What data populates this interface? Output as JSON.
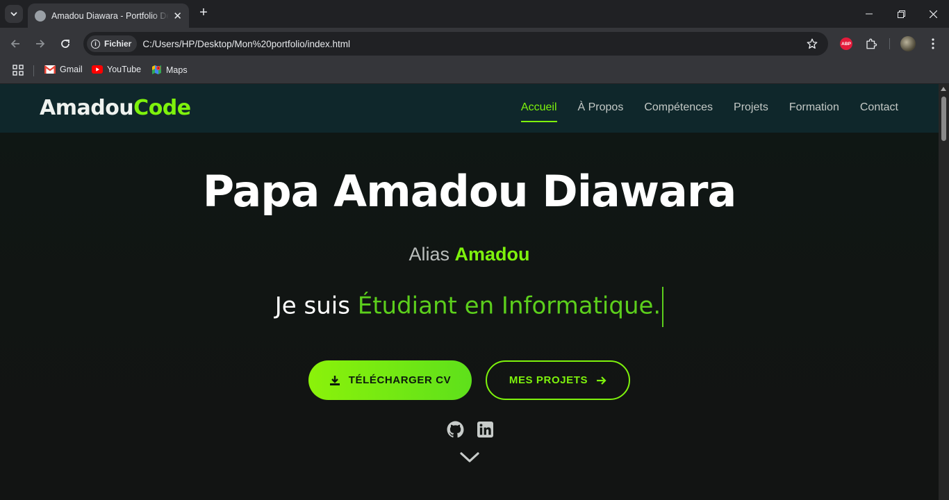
{
  "browser": {
    "tab_title": "Amadou Diawara - Portfolio Dé",
    "url_chip": "Fichier",
    "url": "C:/Users/HP/Desktop/Mon%20portfolio/index.html",
    "bookmarks": [
      {
        "label": "Gmail",
        "icon": "gmail-icon"
      },
      {
        "label": "YouTube",
        "icon": "youtube-icon"
      },
      {
        "label": "Maps",
        "icon": "maps-icon"
      }
    ],
    "extension_badge": "ABP"
  },
  "site": {
    "logo_main": "Amadou",
    "logo_accent": "Code",
    "nav": [
      "Accueil",
      "À Propos",
      "Compétences",
      "Projets",
      "Formation",
      "Contact"
    ],
    "active_nav": "Accueil",
    "hero": {
      "name": "Papa Amadou Diawara",
      "alias_prefix": "Alias",
      "alias_name": "Amadou",
      "typing_prefix": "Je suis",
      "typing_text": "Étudiant en Informatique.",
      "btn_cv": "TÉLÉCHARGER CV",
      "btn_projects": "MES PROJETS"
    }
  },
  "colors": {
    "accent": "#7ef20c",
    "nav_bg": "#0f272b",
    "page_bg": "#111513"
  }
}
